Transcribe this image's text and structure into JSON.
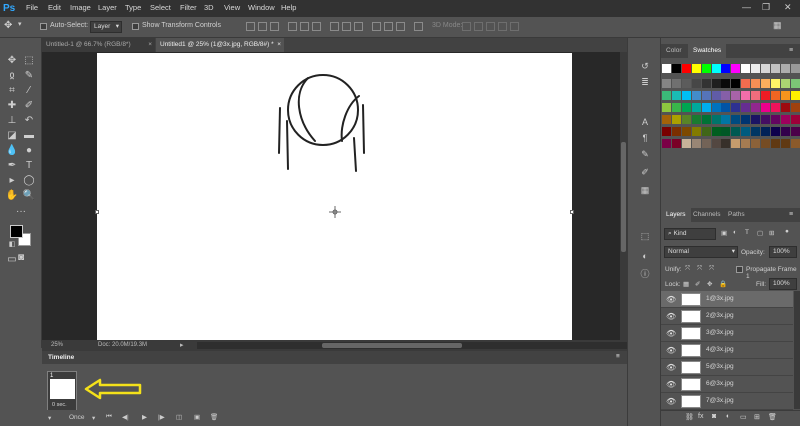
{
  "app": {
    "logo": "Ps"
  },
  "menu": [
    "File",
    "Edit",
    "Image",
    "Layer",
    "Type",
    "Select",
    "Filter",
    "3D",
    "View",
    "Window",
    "Help"
  ],
  "options": {
    "auto_select": "Auto-Select:",
    "auto_select_value": "Layer",
    "show_transform": "Show Transform Controls",
    "mode_3d": "3D Mode:"
  },
  "tabs": [
    {
      "label": "Untitled-1 @ 66.7% (RGB/8*)"
    },
    {
      "label": "Untitled1 @ 25% (1@3x.jpg, RGB/8#) *"
    }
  ],
  "status": {
    "zoom": "25%",
    "doc": "Doc: 20.0M/19.3M"
  },
  "swatches": {
    "tabs": [
      "Color",
      "Swatches"
    ],
    "rows": [
      [
        "#ffffff",
        "#000000",
        "#ff0000",
        "#ffff00",
        "#00ff00",
        "#00ffff",
        "#0000ff",
        "#ff00ff",
        "#ffffff",
        "#ebebeb",
        "#d6d6d6",
        "#c2c2c2",
        "#adadad",
        "#999999"
      ],
      [
        "#858585",
        "#707070",
        "#5c5c5c",
        "#474747",
        "#333333",
        "#1f1f1f",
        "#0a0a0a",
        "#000000",
        "#f26c4f",
        "#f68e55",
        "#fbaf5d",
        "#fff467",
        "#acd372",
        "#7cc576"
      ],
      [
        "#3bb878",
        "#1abbb4",
        "#00bff3",
        "#438cca",
        "#5574b9",
        "#605ca8",
        "#855fa8",
        "#a763a8",
        "#f06ea9",
        "#f26d7d",
        "#ed1c24",
        "#f26522",
        "#f7941d",
        "#fff200"
      ],
      [
        "#8dc63f",
        "#39b54a",
        "#00a651",
        "#00a99d",
        "#00aeef",
        "#0072bc",
        "#0054a6",
        "#2e3192",
        "#662d91",
        "#92278f",
        "#ec008c",
        "#ed145b",
        "#9e0b0f",
        "#a0410d"
      ],
      [
        "#a36209",
        "#aba000",
        "#598527",
        "#197b30",
        "#007236",
        "#00746b",
        "#0076a3",
        "#004b80",
        "#003471",
        "#1b1464",
        "#440e62",
        "#630460",
        "#9e005d",
        "#9e0039"
      ],
      [
        "#790000",
        "#7b2e00",
        "#7d4900",
        "#827b00",
        "#406618",
        "#005e20",
        "#005826",
        "#005952",
        "#005b7f",
        "#003663",
        "#002157",
        "#0d004c",
        "#32004b",
        "#4b0049"
      ],
      [
        "#7b0046",
        "#7a0026",
        "#c7b299",
        "#998675",
        "#736357",
        "#534741",
        "#37302a",
        "#c69c6d",
        "#a67c52",
        "#8c6239",
        "#754c24",
        "#603913",
        "#603913",
        "#8b5a2b"
      ]
    ]
  },
  "layers": {
    "tabs": [
      "Layers",
      "Channels",
      "Paths"
    ],
    "kind": "Kind",
    "blend": "Normal",
    "opacity_label": "Opacity:",
    "opacity": "100%",
    "unify": "Unify:",
    "propagate": "Propagate Frame 1",
    "lock": "Lock:",
    "fill_label": "Fill:",
    "fill": "100%",
    "items": [
      {
        "name": "1@3x.jpg",
        "selected": true
      },
      {
        "name": "2@3x.jpg",
        "selected": false
      },
      {
        "name": "3@3x.jpg",
        "selected": false
      },
      {
        "name": "4@3x.jpg",
        "selected": false
      },
      {
        "name": "5@3x.jpg",
        "selected": false
      },
      {
        "name": "6@3x.jpg",
        "selected": false
      },
      {
        "name": "7@3x.jpg",
        "selected": false
      }
    ]
  },
  "timeline": {
    "title": "Timeline",
    "frame_number": "1",
    "frame_delay": "0 sec.",
    "loop": "Once"
  }
}
